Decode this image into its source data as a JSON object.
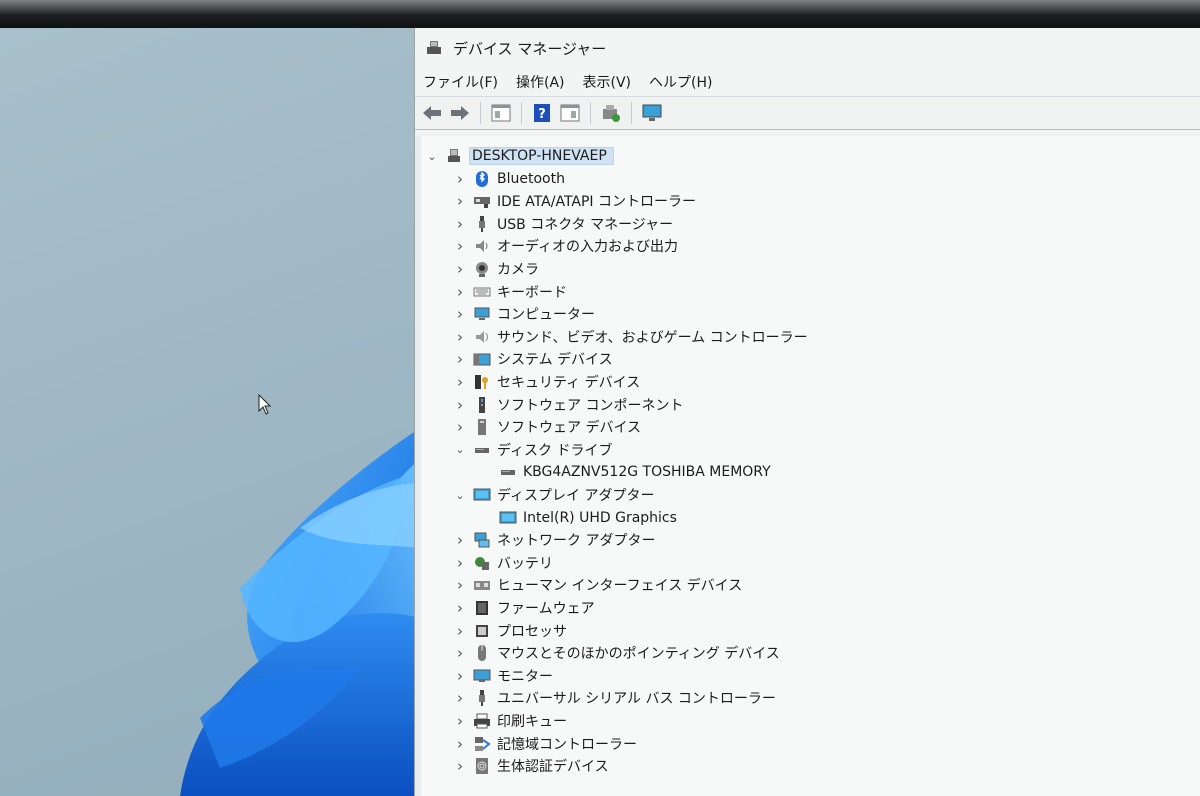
{
  "window": {
    "title": "デバイス マネージャー",
    "menu": [
      "ファイル(F)",
      "操作(A)",
      "表示(V)",
      "ヘルプ(H)"
    ],
    "toolbar_icons": [
      "back-arrow-icon",
      "forward-arrow-icon",
      "properties-pane-icon",
      "help-icon",
      "view-pane-icon",
      "update-driver-icon",
      "monitor-scan-icon"
    ]
  },
  "tree": {
    "root": "DESKTOP-HNEVAEP",
    "categories": [
      {
        "label": "Bluetooth",
        "icon": "bluetooth-icon",
        "expanded": false
      },
      {
        "label": "IDE ATA/ATAPI コントローラー",
        "icon": "ide-controller-icon",
        "expanded": false
      },
      {
        "label": "USB コネクタ マネージャー",
        "icon": "usb-connector-icon",
        "expanded": false
      },
      {
        "label": "オーディオの入力および出力",
        "icon": "speaker-icon",
        "expanded": false
      },
      {
        "label": "カメラ",
        "icon": "camera-icon",
        "expanded": false
      },
      {
        "label": "キーボード",
        "icon": "keyboard-icon",
        "expanded": false
      },
      {
        "label": "コンピューター",
        "icon": "computer-icon",
        "expanded": false
      },
      {
        "label": "サウンド、ビデオ、およびゲーム コントローラー",
        "icon": "sound-icon",
        "expanded": false
      },
      {
        "label": "システム デバイス",
        "icon": "system-device-icon",
        "expanded": false
      },
      {
        "label": "セキュリティ デバイス",
        "icon": "security-key-icon",
        "expanded": false
      },
      {
        "label": "ソフトウェア コンポーネント",
        "icon": "software-component-icon",
        "expanded": false
      },
      {
        "label": "ソフトウェア デバイス",
        "icon": "software-device-icon",
        "expanded": false
      },
      {
        "label": "ディスク ドライブ",
        "icon": "disk-drive-icon",
        "expanded": true,
        "children": [
          {
            "label": "KBG4AZNV512G TOSHIBA MEMORY",
            "icon": "disk-drive-icon"
          }
        ]
      },
      {
        "label": "ディスプレイ アダプター",
        "icon": "display-adapter-icon",
        "expanded": true,
        "children": [
          {
            "label": "Intel(R) UHD Graphics",
            "icon": "display-adapter-icon"
          }
        ]
      },
      {
        "label": "ネットワーク アダプター",
        "icon": "network-adapter-icon",
        "expanded": false
      },
      {
        "label": "バッテリ",
        "icon": "battery-icon",
        "expanded": false
      },
      {
        "label": "ヒューマン インターフェイス デバイス",
        "icon": "hid-icon",
        "expanded": false
      },
      {
        "label": "ファームウェア",
        "icon": "firmware-icon",
        "expanded": false
      },
      {
        "label": "プロセッサ",
        "icon": "processor-icon",
        "expanded": false
      },
      {
        "label": "マウスとそのほかのポインティング デバイス",
        "icon": "mouse-icon",
        "expanded": false
      },
      {
        "label": "モニター",
        "icon": "monitor-icon",
        "expanded": false
      },
      {
        "label": "ユニバーサル シリアル バス コントローラー",
        "icon": "usb-controller-icon",
        "expanded": false
      },
      {
        "label": "印刷キュー",
        "icon": "printer-icon",
        "expanded": false
      },
      {
        "label": "記憶域コントローラー",
        "icon": "storage-controller-icon",
        "expanded": false
      },
      {
        "label": "生体認証デバイス",
        "icon": "biometric-icon",
        "expanded": false
      }
    ]
  }
}
